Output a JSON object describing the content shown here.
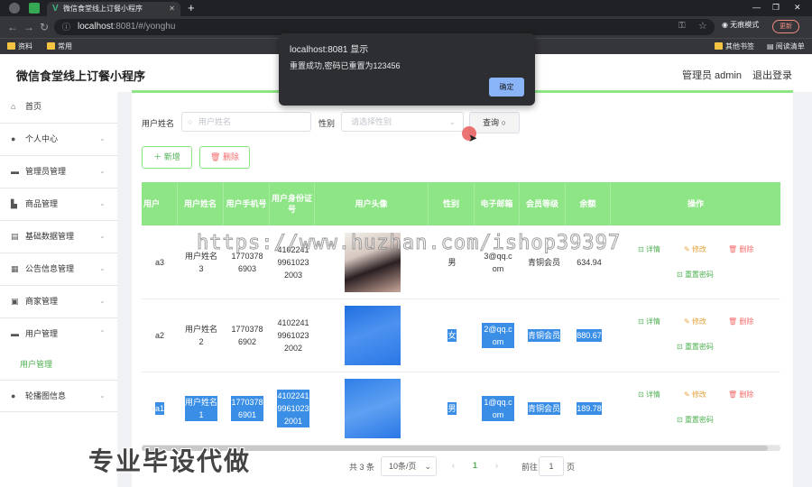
{
  "browser": {
    "tab_title": "微信食堂线上订餐小程序",
    "url_host": "localhost",
    "url_rest": ":8081/#/yonghu",
    "incognito_label": "无痕模式",
    "update_label": "更新",
    "bookmarks": [
      "资料",
      "常用"
    ],
    "bookmarks_right": [
      "其他书签",
      "阅读清单"
    ]
  },
  "app": {
    "title": "微信食堂线上订餐小程序",
    "user": "管理员 admin",
    "logout": "退出登录"
  },
  "sidebar": {
    "items": [
      "首页",
      "个人中心",
      "管理员管理",
      "商品管理",
      "基础数据管理",
      "公告信息管理",
      "商家管理",
      "用户管理",
      "轮播图信息"
    ],
    "sub_item": "用户管理"
  },
  "search": {
    "name_label": "用户姓名",
    "name_placeholder": "用户姓名",
    "gender_label": "性别",
    "gender_placeholder": "请选择性别",
    "search_button": "查询"
  },
  "actions": {
    "add": "新增",
    "delete": "删除"
  },
  "table": {
    "headers": [
      "用户",
      "用户姓名",
      "用户手机号",
      "用户身份证号",
      "用户头像",
      "性别",
      "电子邮箱",
      "会员等级",
      "余额",
      "操作"
    ],
    "rows": [
      {
        "account": "a3",
        "name": "用户姓名3",
        "phone": "17703786903",
        "idcard": "410224199610232003",
        "gender": "男",
        "email": "3@qq.com",
        "level": "青铜会员",
        "balance": "634.94"
      },
      {
        "account": "a2",
        "name": "用户姓名2",
        "phone": "17703786902",
        "idcard": "410224199610232002",
        "gender": "女",
        "email": "2@qq.com",
        "level": "青铜会员",
        "balance": "880.67"
      },
      {
        "account": "a1",
        "name": "用户姓名1",
        "phone": "17703786901",
        "idcard": "410224199610232001",
        "gender": "男",
        "email": "1@qq.com",
        "level": "青铜会员",
        "balance": "189.78"
      }
    ],
    "op_detail": "详情",
    "op_edit": "修改",
    "op_delete": "删除",
    "op_reset": "重置密码"
  },
  "pager": {
    "total": "共 3 条",
    "page_size": "10条/页",
    "current": "1",
    "goto_label": "前往",
    "goto_value": "1",
    "page_unit": "页"
  },
  "dialog": {
    "title": "localhost:8081 显示",
    "message": "重置成功,密码已重置为123456",
    "ok": "确定"
  },
  "overlay": {
    "watermark": "https://www.huzhan.com/ishop39397",
    "caption": "专业毕设代做"
  }
}
